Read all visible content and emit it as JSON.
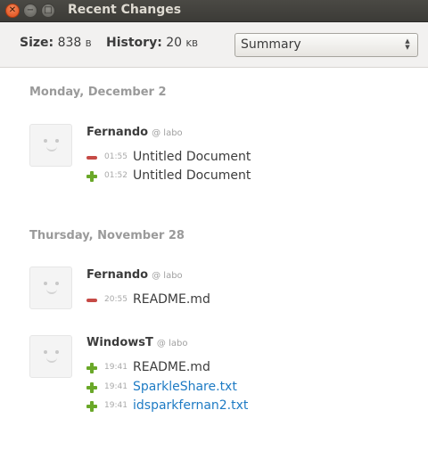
{
  "window": {
    "title": "Recent Changes"
  },
  "toolbar": {
    "size_label": "Size:",
    "size_value": "838",
    "size_unit": "B",
    "history_label": "History:",
    "history_value": "20",
    "history_unit": "KB",
    "view_select": {
      "selected": "Summary"
    }
  },
  "days": [
    {
      "header": "Monday, December 2",
      "groups": [
        {
          "user": "Fernando",
          "host": "@ labo",
          "entries": [
            {
              "type": "removed",
              "time": "01:55",
              "file": "Untitled Document",
              "link": false
            },
            {
              "type": "added",
              "time": "01:52",
              "file": "Untitled Document",
              "link": false
            }
          ]
        }
      ]
    },
    {
      "header": "Thursday, November 28",
      "groups": [
        {
          "user": "Fernando",
          "host": "@ labo",
          "entries": [
            {
              "type": "removed",
              "time": "20:55",
              "file": "README.md",
              "link": false
            }
          ]
        },
        {
          "user": "WindowsT",
          "host": "@ labo",
          "entries": [
            {
              "type": "added",
              "time": "19:41",
              "file": "README.md",
              "link": false
            },
            {
              "type": "added",
              "time": "19:41",
              "file": "SparkleShare.txt",
              "link": true
            },
            {
              "type": "added",
              "time": "19:41",
              "file": "idsparkfernan2.txt",
              "link": true
            }
          ]
        }
      ]
    }
  ],
  "colors": {
    "link": "#1e7bc4",
    "removed": "#c64a46",
    "added": "#6aa829",
    "close_button": "#df4a16"
  }
}
